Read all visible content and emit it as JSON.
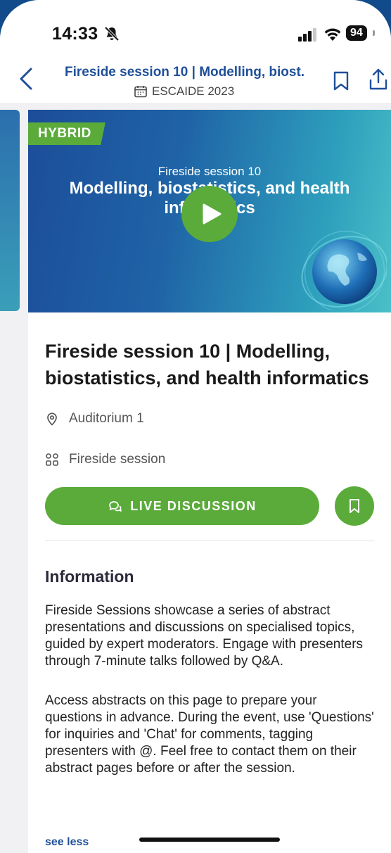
{
  "status_bar": {
    "time": "14:33",
    "battery": "94"
  },
  "header": {
    "title": "Fireside session 10 | Modelling, biost...",
    "event": "ESCAIDE 2023"
  },
  "banner": {
    "badge": "HYBRID",
    "subtitle": "Fireside session 10",
    "title": "Modelling, biostatistics, and health informatics"
  },
  "session": {
    "title": "Fireside session 10 | Modelling, biostatistics, and health informatics",
    "location": "Auditorium 1",
    "type": "Fireside session",
    "live_button": "LIVE DISCUSSION"
  },
  "information": {
    "heading": "Information",
    "paragraph1": "Fireside Sessions showcase a series of abstract presentations and discussions on specialised topics, guided by expert moderators. Engage with presenters through 7-minute talks followed by Q&A.",
    "paragraph2": "Access abstracts on this page to prepare your questions in advance. During the event, use 'Questions' for inquiries and 'Chat' for comments, tagging presenters with @. Feel free to contact them on their abstract pages before or after the session.",
    "toggle": "see less"
  },
  "colors": {
    "accent_green": "#5aab3a",
    "link_blue": "#1f4f99"
  },
  "icons": [
    "bell-slash-icon",
    "signal-icon",
    "wifi-icon",
    "back-chevron-icon",
    "calendar-icon",
    "bookmark-icon",
    "share-icon",
    "play-icon",
    "location-pin-icon",
    "category-grid-icon",
    "chat-icon"
  ]
}
